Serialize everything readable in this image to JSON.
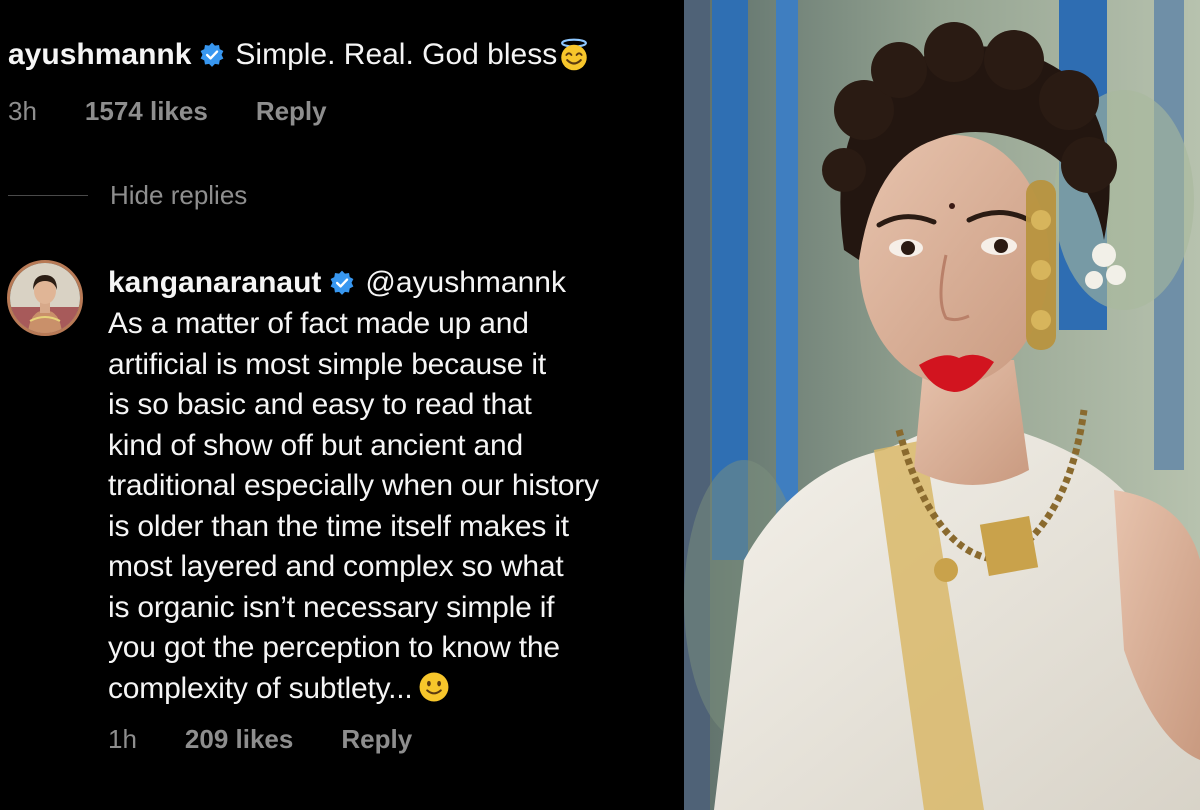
{
  "top_comment": {
    "username": "ayushmannk",
    "text": "Simple. Real. God bless",
    "emoji_icon": "smiling-face-with-halo-icon",
    "time": "3h",
    "likes": "1574 likes",
    "reply_label": "Reply"
  },
  "replies_toggle": {
    "label": "Hide replies"
  },
  "reply": {
    "username": "kanganaranaut",
    "mention": "@ayushmannk",
    "lines": [
      "As a matter of fact made up and",
      "artificial is most simple because it",
      "is so basic and easy to read that",
      "kind of show off but ancient and",
      "traditional especially when our history",
      "is older than the time itself makes it",
      "most layered and complex so what",
      "is organic isn’t necessary simple if",
      "you got the perception to know the",
      "complexity of subtlety..."
    ],
    "emoji_icon": "slightly-smiling-face-icon",
    "time": "1h",
    "likes": "209 likes",
    "reply_label": "Reply"
  },
  "colors": {
    "background": "#000000",
    "text_primary": "#f5f5f5",
    "text_secondary": "#8e8e8e",
    "verified_badge": "#3897f0",
    "emoji_yellow": "#f7c62b"
  }
}
